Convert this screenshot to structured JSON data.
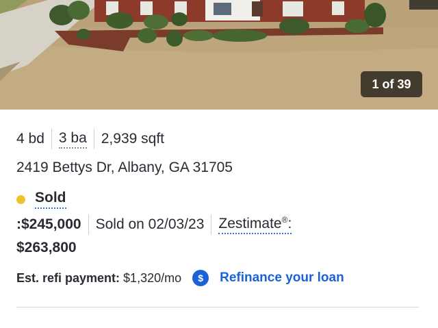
{
  "photo": {
    "counter": "1 of 39"
  },
  "facts": {
    "beds": "4 bd",
    "baths": "3 ba",
    "sqft": "2,939 sqft"
  },
  "address": "2419 Bettys Dr, Albany, GA 31705",
  "status": {
    "label": "Sold",
    "dot_color": "#f2c12e"
  },
  "price": {
    "prefix": ": ",
    "value": "$245,000",
    "sold_on": "Sold on 02/03/23",
    "zestimate_label": "Zestimate",
    "zestimate_mark": "®",
    "zestimate_colon": ":",
    "zestimate_value": "$263,800"
  },
  "refi": {
    "label": "Est. refi payment:",
    "amount": "$1,320/mo",
    "icon_glyph": "$",
    "link_text": "Refinance your loan",
    "icon_name": "dollar-circle-icon",
    "link_color": "#1a62d6"
  }
}
